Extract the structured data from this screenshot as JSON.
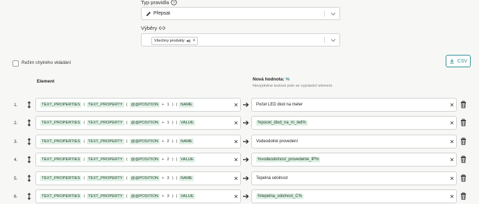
{
  "rule_type": {
    "label": "Typ pravidla",
    "help_icon": "help-circle-icon",
    "selected": "Přepsat"
  },
  "selections": {
    "label": "Výběry",
    "link_icon": "link-icon",
    "chip_label": "Všechny produkty"
  },
  "smart_insert": {
    "label": "Režim chytrého vkládání"
  },
  "csv_button": {
    "label": "CSV"
  },
  "columns": {
    "element": "Element",
    "new_value": "Nová hodnota:",
    "new_value_symbol": "%",
    "new_value_hint": "Nevyplněné textové pole se vyprázdní element."
  },
  "rows": [
    {
      "number": "1.",
      "position": "1",
      "field": "NAME",
      "value": "Počet LED diod na meter",
      "value_is_token": false
    },
    {
      "number": "2.",
      "position": "1",
      "field": "VALUE",
      "value": "%pocet_diod_na_m_led%",
      "value_is_token": true
    },
    {
      "number": "3.",
      "position": "2",
      "field": "NAME",
      "value": "Vodeodolné provedení",
      "value_is_token": false
    },
    {
      "number": "4.",
      "position": "2",
      "field": "VALUE",
      "value": "%vodeodolnost_provedenie_IP%",
      "value_is_token": true
    },
    {
      "number": "5.",
      "position": "3",
      "field": "NAME",
      "value": "Tepelná odolnost",
      "value_is_token": false
    },
    {
      "number": "6.",
      "position": "3",
      "field": "VALUE",
      "value": "%tepelna_odolnost_C%",
      "value_is_token": true
    }
  ],
  "tokens": {
    "group": "TEXT_PROPERTIES",
    "sep": "|",
    "item": "TEXT_PROPERTY",
    "open": "(",
    "var": "@@POSITION",
    "plus": "+",
    "close": ")"
  },
  "colors": {
    "accent": "#2f8f93",
    "token_bg": "#dff0e4"
  }
}
